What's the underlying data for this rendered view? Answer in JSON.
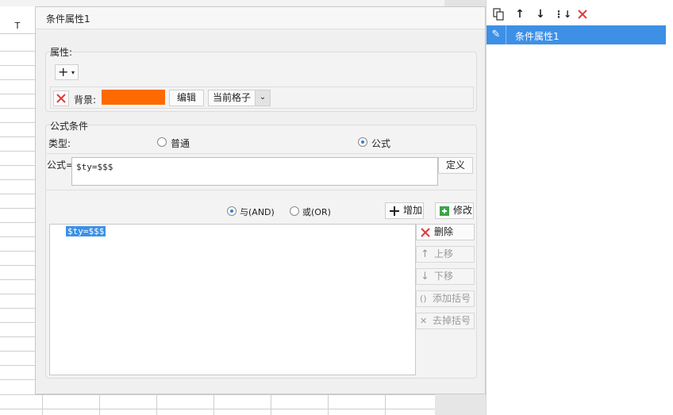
{
  "spreadsheet": {
    "column_header": "T"
  },
  "dialog": {
    "title": "条件属性1",
    "attributes": {
      "group_label": "属性:",
      "add_symbol": "+",
      "background_label": "背景:",
      "background_color": "#ff6a00",
      "edit_button": "编辑",
      "scope_select": "当前格子"
    },
    "formula_condition": {
      "group_label": "公式条件",
      "type_label": "类型:",
      "type_options": [
        "普通",
        "公式"
      ],
      "type_selected": "公式",
      "formula_label": "公式=",
      "formula_value": "$ty=$$$",
      "define_button": "定义",
      "logic_options": [
        "与(AND)",
        "或(OR)"
      ],
      "logic_selected": "与(AND)",
      "add_button": "增加",
      "modify_button": "修改",
      "conditions": [
        "$ty=$$$"
      ],
      "delete_button": "删除",
      "move_up_button": "上移",
      "move_down_button": "下移",
      "add_bracket_button": "添加括号",
      "remove_bracket_button": "去掉括号"
    }
  },
  "right_panel": {
    "items": [
      "条件属性1"
    ]
  },
  "colors": {
    "accent": "#3d90e6",
    "delete_red": "#e03a3a"
  }
}
